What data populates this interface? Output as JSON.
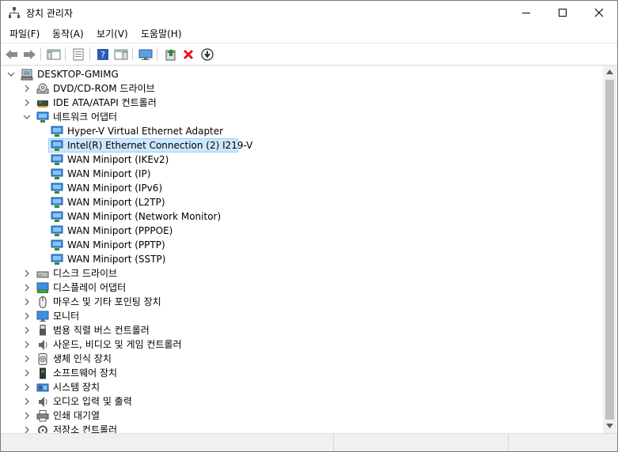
{
  "window": {
    "title": "장치 관리자"
  },
  "menu": [
    "파일(F)",
    "동작(A)",
    "보기(V)",
    "도움말(H)"
  ],
  "tree": {
    "root": "DESKTOP-GMIMG",
    "items": [
      {
        "label": "DVD/CD-ROM 드라이브",
        "icon": "dvd-drive-icon",
        "expanded": false
      },
      {
        "label": "IDE ATA/ATAPI 컨트롤러",
        "icon": "ide-controller-icon",
        "expanded": false
      },
      {
        "label": "네트워크 어댑터",
        "icon": "network-adapter-icon",
        "expanded": true
      },
      {
        "label": "Hyper-V Virtual Ethernet Adapter",
        "icon": "network-adapter-icon",
        "child": true
      },
      {
        "label": "Intel(R) Ethernet Connection (2) I219-V",
        "icon": "network-adapter-icon",
        "child": true,
        "selected": true
      },
      {
        "label": "WAN Miniport (IKEv2)",
        "icon": "network-adapter-icon",
        "child": true
      },
      {
        "label": "WAN Miniport (IP)",
        "icon": "network-adapter-icon",
        "child": true
      },
      {
        "label": "WAN Miniport (IPv6)",
        "icon": "network-adapter-icon",
        "child": true
      },
      {
        "label": "WAN Miniport (L2TP)",
        "icon": "network-adapter-icon",
        "child": true
      },
      {
        "label": "WAN Miniport (Network Monitor)",
        "icon": "network-adapter-icon",
        "child": true
      },
      {
        "label": "WAN Miniport (PPPOE)",
        "icon": "network-adapter-icon",
        "child": true
      },
      {
        "label": "WAN Miniport (PPTP)",
        "icon": "network-adapter-icon",
        "child": true
      },
      {
        "label": "WAN Miniport (SSTP)",
        "icon": "network-adapter-icon",
        "child": true
      },
      {
        "label": "디스크 드라이브",
        "icon": "disk-drive-icon",
        "expanded": false
      },
      {
        "label": "디스플레이 어댑터",
        "icon": "display-adapter-icon",
        "expanded": false
      },
      {
        "label": "마우스 및 기타 포인팅 장치",
        "icon": "mouse-icon",
        "expanded": false
      },
      {
        "label": "모니터",
        "icon": "monitor-icon",
        "expanded": false
      },
      {
        "label": "범용 직렬 버스 컨트롤러",
        "icon": "usb-icon",
        "expanded": false
      },
      {
        "label": "사운드, 비디오 및 게임 컨트롤러",
        "icon": "sound-icon",
        "expanded": false
      },
      {
        "label": "생체 인식 장치",
        "icon": "biometric-icon",
        "expanded": false
      },
      {
        "label": "소프트웨어 장치",
        "icon": "software-device-icon",
        "expanded": false
      },
      {
        "label": "시스템 장치",
        "icon": "system-device-icon",
        "expanded": false
      },
      {
        "label": "오디오 입력 및 출력",
        "icon": "audio-io-icon",
        "expanded": false
      },
      {
        "label": "인쇄 대기열",
        "icon": "print-queue-icon",
        "expanded": false
      },
      {
        "label": "저장소 컨트롤러",
        "icon": "storage-controller-icon",
        "expanded": false
      }
    ]
  },
  "colors": {
    "selection": "#cce8ff",
    "selection_border": "#99d1ff",
    "adapter_blue": "#1e7bd6",
    "delete_red": "#e81123",
    "update_green": "#2e8b2e"
  }
}
